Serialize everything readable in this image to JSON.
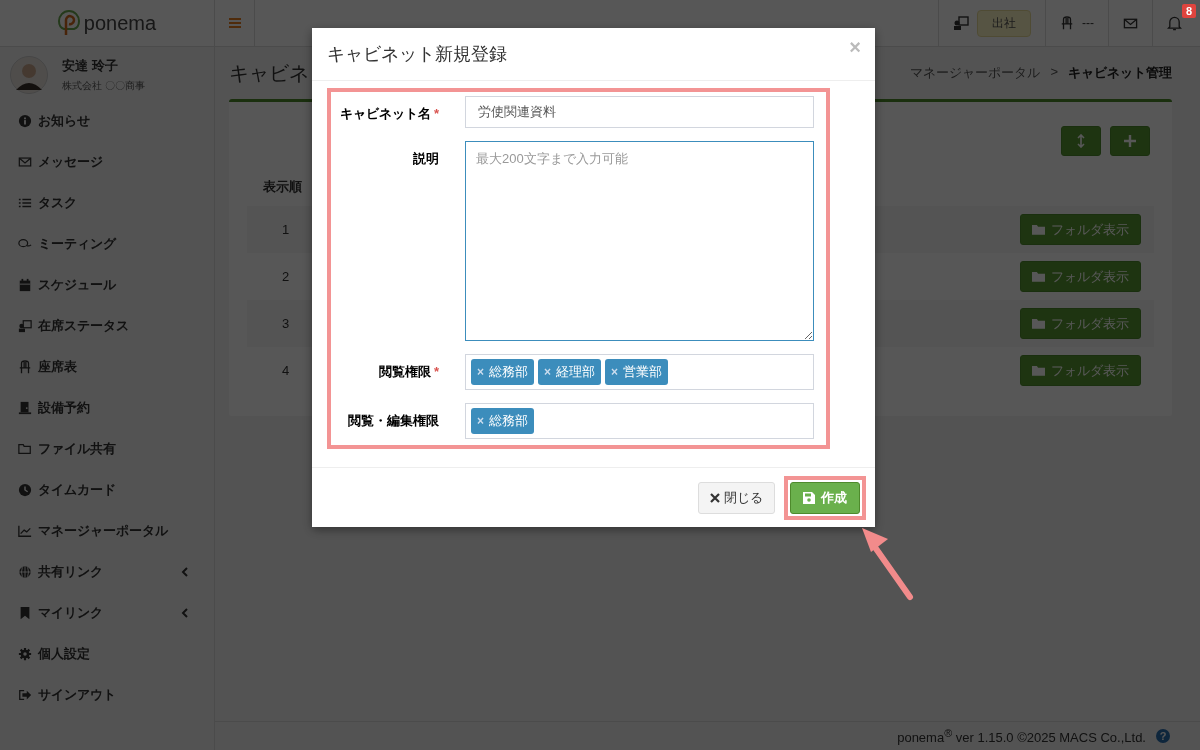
{
  "brand": {
    "name": "ponema"
  },
  "header": {
    "presence": "出社",
    "seat": "---",
    "notifications": "8"
  },
  "user": {
    "name": "安達 玲子",
    "company": "株式会社 〇〇商事"
  },
  "sidebar": {
    "items": [
      {
        "label": "お知らせ",
        "kind": "link"
      },
      {
        "label": "メッセージ",
        "kind": "link"
      },
      {
        "label": "タスク",
        "kind": "link"
      },
      {
        "label": "ミーティング",
        "kind": "link"
      },
      {
        "label": "スケジュール",
        "kind": "link"
      },
      {
        "label": "在席ステータス",
        "kind": "link"
      },
      {
        "label": "座席表",
        "kind": "link"
      },
      {
        "label": "設備予約",
        "kind": "link"
      },
      {
        "label": "ファイル共有",
        "kind": "link"
      },
      {
        "label": "タイムカード",
        "kind": "link"
      },
      {
        "label": "マネージャーポータル",
        "kind": "link"
      },
      {
        "label": "共有リンク",
        "kind": "group"
      },
      {
        "label": "マイリンク",
        "kind": "group"
      },
      {
        "label": "個人設定",
        "kind": "link"
      },
      {
        "label": "サインアウト",
        "kind": "link"
      }
    ]
  },
  "page": {
    "title": "キャビネ",
    "breadcrumb": [
      "マネージャーポータル",
      ">",
      "キャビネット管理"
    ]
  },
  "table": {
    "columns": [
      "表示順"
    ],
    "rows": [
      {
        "order": "1",
        "action": "フォルダ表示"
      },
      {
        "order": "2",
        "action": "フォルダ表示"
      },
      {
        "order": "3",
        "action": "フォルダ表示"
      },
      {
        "order": "4",
        "action": "フォルダ表示"
      }
    ]
  },
  "footer": {
    "text": "ponema$^{®}$ ver 1.15.0 ©2025 MACS Co.,Ltd.",
    "help": "?"
  },
  "modal": {
    "title": "キャビネット新規登録",
    "close": "×",
    "required_mark": "*",
    "tag_remove": "×",
    "fields": [
      {
        "label": "キャビネット名",
        "required": true,
        "kind": "text",
        "value": "労使関連資料"
      },
      {
        "label": "説明",
        "required": false,
        "kind": "textarea",
        "placeholder": "最大200文字まで入力可能"
      },
      {
        "label": "閲覧権限",
        "required": true,
        "kind": "tags",
        "tags": [
          "総務部",
          "経理部",
          "営業部"
        ]
      },
      {
        "label": "閲覧・編集権限",
        "required": false,
        "kind": "tags",
        "tags": [
          "総務部"
        ]
      }
    ],
    "buttons": [
      {
        "label": "閉じる",
        "kind": "close"
      },
      {
        "label": "作成",
        "kind": "create"
      }
    ]
  }
}
